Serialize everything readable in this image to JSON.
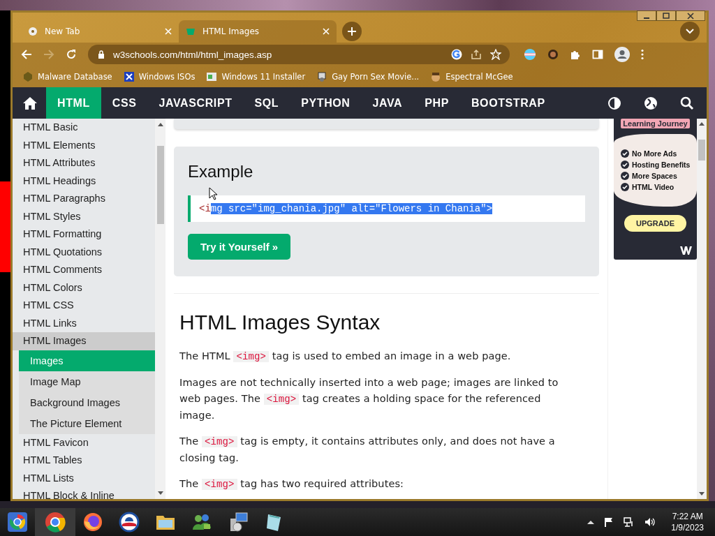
{
  "browser": {
    "tabs": [
      {
        "title": "New Tab",
        "selected": false
      },
      {
        "title": "HTML Images",
        "selected": true
      }
    ],
    "url": "w3schools.com/html/html_images.asp",
    "bookmarks": [
      "Malware Database",
      "Windows ISOs",
      "Windows 11 Installer",
      "Gay Porn Sex Movie...",
      "Espectral McGee"
    ]
  },
  "nav": {
    "items": [
      {
        "label": "HTML",
        "selected": true
      },
      {
        "label": "CSS",
        "selected": false
      },
      {
        "label": "JAVASCRIPT",
        "selected": false
      },
      {
        "label": "SQL",
        "selected": false
      },
      {
        "label": "PYTHON",
        "selected": false
      },
      {
        "label": "JAVA",
        "selected": false
      },
      {
        "label": "PHP",
        "selected": false
      },
      {
        "label": "BOOTSTRAP",
        "selected": false
      }
    ]
  },
  "sidebar": {
    "items": [
      {
        "label": "HTML Basic",
        "selected": false,
        "expanded": false
      },
      {
        "label": "HTML Elements",
        "selected": false,
        "expanded": false
      },
      {
        "label": "HTML Attributes",
        "selected": false,
        "expanded": false
      },
      {
        "label": "HTML Headings",
        "selected": false,
        "expanded": false
      },
      {
        "label": "HTML Paragraphs",
        "selected": false,
        "expanded": false
      },
      {
        "label": "HTML Styles",
        "selected": false,
        "expanded": false
      },
      {
        "label": "HTML Formatting",
        "selected": false,
        "expanded": false
      },
      {
        "label": "HTML Quotations",
        "selected": false,
        "expanded": false
      },
      {
        "label": "HTML Comments",
        "selected": false,
        "expanded": false
      },
      {
        "label": "HTML Colors",
        "selected": false,
        "expanded": false
      },
      {
        "label": "HTML CSS",
        "selected": false,
        "expanded": false
      },
      {
        "label": "HTML Links",
        "selected": false,
        "expanded": false
      },
      {
        "label": "HTML Images",
        "selected": false,
        "expanded": true,
        "children": [
          {
            "label": "Images",
            "selected": true
          },
          {
            "label": "Image Map",
            "selected": false
          },
          {
            "label": "Background Images",
            "selected": false
          },
          {
            "label": "The Picture Element",
            "selected": false
          }
        ]
      },
      {
        "label": "HTML Favicon",
        "selected": false,
        "expanded": false
      },
      {
        "label": "HTML Tables",
        "selected": false,
        "expanded": false
      },
      {
        "label": "HTML Lists",
        "selected": false,
        "expanded": false
      },
      {
        "label": "HTML Block & Inline",
        "selected": false,
        "expanded": false
      }
    ]
  },
  "example": {
    "title": "Example",
    "code": [
      {
        "text": "<i",
        "selected": false
      },
      {
        "text": "mg src=\"img_chania.jpg\" alt=\"Flowers in Chania\">",
        "selected": true
      }
    ],
    "button": "Try it Yourself »"
  },
  "section": {
    "heading": "HTML Images Syntax",
    "paragraphs": [
      [
        {
          "kind": "text",
          "text": "The HTML "
        },
        {
          "kind": "code",
          "text": "<img>"
        },
        {
          "kind": "text",
          "text": " tag is used to embed an image in a web page."
        }
      ],
      [
        {
          "kind": "text",
          "text": "Images are not technically inserted into a web page; images are linked to web pages. The "
        },
        {
          "kind": "code",
          "text": "<img>"
        },
        {
          "kind": "text",
          "text": " tag creates a holding space for the referenced image."
        }
      ],
      [
        {
          "kind": "text",
          "text": "The "
        },
        {
          "kind": "code",
          "text": "<img>"
        },
        {
          "kind": "text",
          "text": " tag is empty, it contains attributes only, and does not have a closing tag."
        }
      ],
      [
        {
          "kind": "text",
          "text": "The "
        },
        {
          "kind": "code",
          "text": "<img>"
        },
        {
          "kind": "text",
          "text": " tag has two required attributes:"
        }
      ]
    ]
  },
  "ad": {
    "badge": "Learning Journey",
    "features": [
      "No More Ads",
      "Hosting Benefits",
      "More Spaces",
      "HTML Video"
    ],
    "button": "UPGRADE"
  },
  "taskbar": {
    "time": "7:22 AM",
    "date": "1/9/2023"
  }
}
